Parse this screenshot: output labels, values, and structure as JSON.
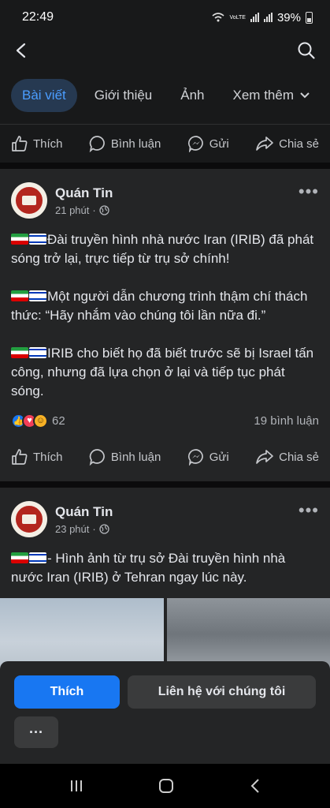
{
  "status": {
    "time": "22:49",
    "battery": "39%",
    "network": "VoLTE"
  },
  "tabs": [
    {
      "label": "Bài viết"
    },
    {
      "label": "Giới thiệu"
    },
    {
      "label": "Ảnh"
    },
    {
      "label": "Xem thêm"
    }
  ],
  "actions": {
    "like": "Thích",
    "comment": "Bình luận",
    "send": "Gửi",
    "share": "Chia sẻ"
  },
  "posts": [
    {
      "page_name": "Quán Tin",
      "time": "21 phút",
      "paragraphs": [
        "Đài truyền hình nhà nước Iran (IRIB) đã phát sóng trở lại, trực tiếp từ trụ sở chính!",
        "Một người dẫn chương trình thậm chí thách thức: “Hãy nhắm vào chúng tôi lần nữa đi.”",
        "IRIB cho biết họ đã biết trước sẽ bị Israel tấn công, nhưng đã lựa chọn ở lại và tiếp tục phát sóng."
      ],
      "reaction_count": "62",
      "comment_count": "19 bình luận"
    },
    {
      "page_name": "Quán Tin",
      "time": "23 phút",
      "paragraphs": [
        "- Hình ảnh từ trụ sở Đài truyền hình nhà nước Iran (IRIB) ở Tehran ngay lúc này."
      ]
    }
  ],
  "bottom": {
    "like_label": "Thích",
    "contact_label": "Liên hệ với chúng tôi",
    "more_label": "···"
  },
  "colors": {
    "accent": "#1877f2",
    "background": "#18191a",
    "card": "#242526",
    "active_tab": "#4b9dff"
  }
}
